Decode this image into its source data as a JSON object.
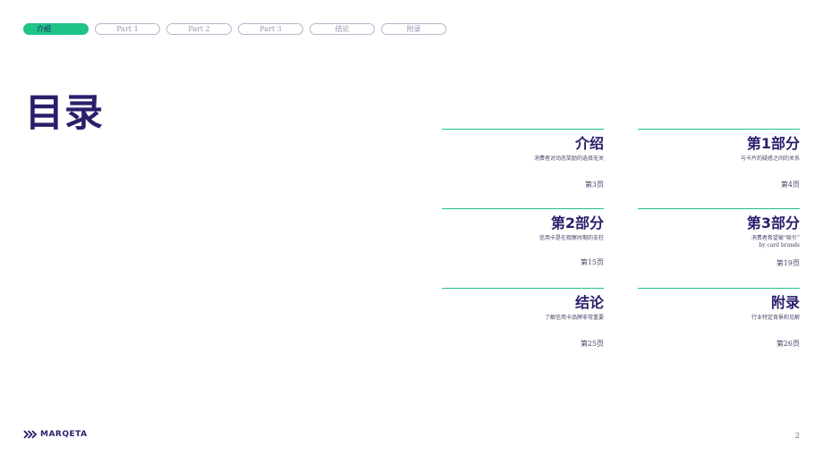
{
  "nav": {
    "tabs": [
      {
        "label": "介绍",
        "active": true
      },
      {
        "label": "Part 1",
        "active": false
      },
      {
        "label": "Part 2",
        "active": false
      },
      {
        "label": "Part 3",
        "active": false
      },
      {
        "label": "结论",
        "active": false
      },
      {
        "label": "附录",
        "active": false
      }
    ]
  },
  "page_title": "目录",
  "sections": [
    {
      "title": "介绍",
      "desc": [
        "消费者对动态奖励的选择无关"
      ],
      "page": "第3页"
    },
    {
      "title": "第1部分",
      "desc": [
        "与卡片的疑惑之间的关系"
      ],
      "page": "第4页"
    },
    {
      "title": "第2部分",
      "desc": [
        "信用卡是在观察时期的支柱"
      ],
      "page": "第15页"
    },
    {
      "title": "第3部分",
      "desc": [
        "消费者希望被“吸引”",
        "by card brands"
      ],
      "page": "第19页"
    },
    {
      "title": "结论",
      "desc": [
        "了解信用卡品牌非常重要"
      ],
      "page": "第25页"
    },
    {
      "title": "附录",
      "desc": [
        "行业特定背景和见解"
      ],
      "page": "第26页"
    }
  ],
  "footer": {
    "logo_text": "MARQETA",
    "page_number": "2"
  },
  "colors": {
    "accent": "#1fc487",
    "brand": "#2a1f6b"
  }
}
